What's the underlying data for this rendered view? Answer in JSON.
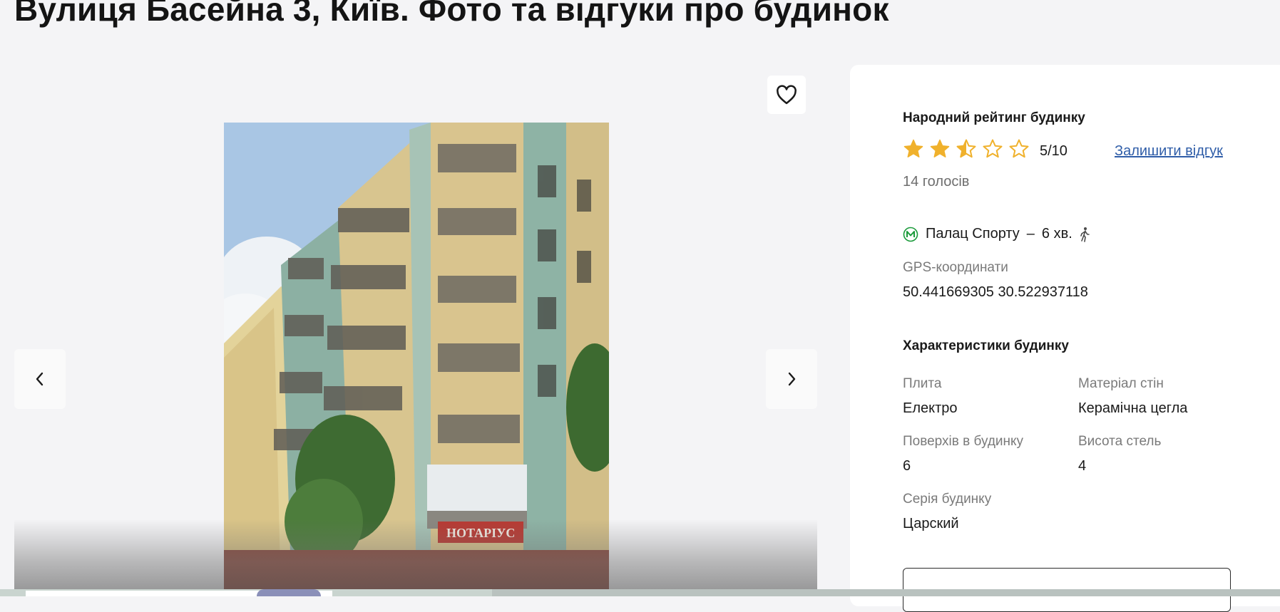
{
  "page": {
    "title": "Вулиця Басейна 3, Київ. Фото та відгуки про будинок"
  },
  "gallery": {
    "favorite_icon": "heart-outline-icon",
    "prev_icon": "chevron-left-icon",
    "next_icon": "chevron-right-icon",
    "photo_sign_text": "НОТАРІУС"
  },
  "rating": {
    "heading": "Народний рейтинг будинку",
    "value": "5/10",
    "score_out_of_5": 2.5,
    "star_color": "#f0b12c",
    "leave_review_label": "Залишити відгук",
    "votes": "14 голосів"
  },
  "location": {
    "metro_icon": "metro-icon",
    "metro_station": "Палац Спорту",
    "separator": "–",
    "walk_time": "6 хв.",
    "walk_icon": "walking-person-icon",
    "metro_color": "#1a9a3a",
    "gps_label": "GPS-координати",
    "gps_value": "50.441669305 30.522937118"
  },
  "characteristics": {
    "heading": "Характеристики будинку",
    "items": [
      {
        "label": "Плита",
        "value": "Електро"
      },
      {
        "label": "Матеріал стін",
        "value": "Керамічна цегла"
      },
      {
        "label": "Поверхів в будинку",
        "value": "6"
      },
      {
        "label": "Висота стель",
        "value": "4"
      },
      {
        "label": "Серія будинку",
        "value": "Царский"
      }
    ]
  }
}
